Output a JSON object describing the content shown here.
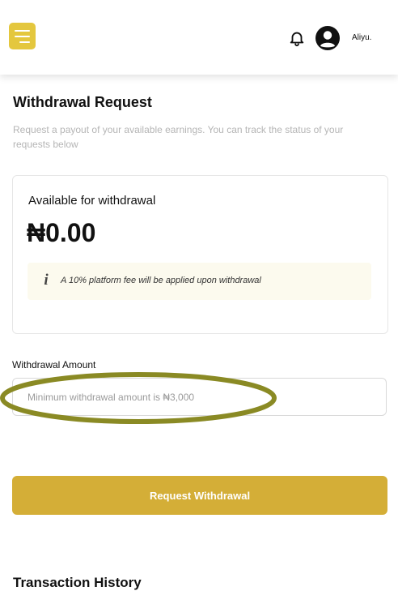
{
  "header": {
    "menu_icon": "hamburger-menu-icon",
    "bell_icon": "bell-icon",
    "avatar_icon": "user-avatar-icon",
    "username": "Aliyu.",
    "accent_color": "#e4c73e"
  },
  "page": {
    "title": "Withdrawal Request",
    "description": "Request a payout of your available earnings. You can track the status of your requests below"
  },
  "balance_card": {
    "label": "Available for withdrawal",
    "amount": "₦0.00",
    "notice_icon": "info-icon",
    "notice_text": "A 10% platform fee will be applied upon withdrawal",
    "notice_bg": "#fcfaee"
  },
  "form": {
    "amount_label": "Withdrawal Amount",
    "amount_value": "",
    "amount_placeholder": "Minimum withdrawal amount is ₦3,000",
    "submit_label": "Request Withdrawal",
    "submit_color": "#d4ae37"
  },
  "annotation": {
    "color": "#8a8a24"
  },
  "history": {
    "title": "Transaction History"
  }
}
